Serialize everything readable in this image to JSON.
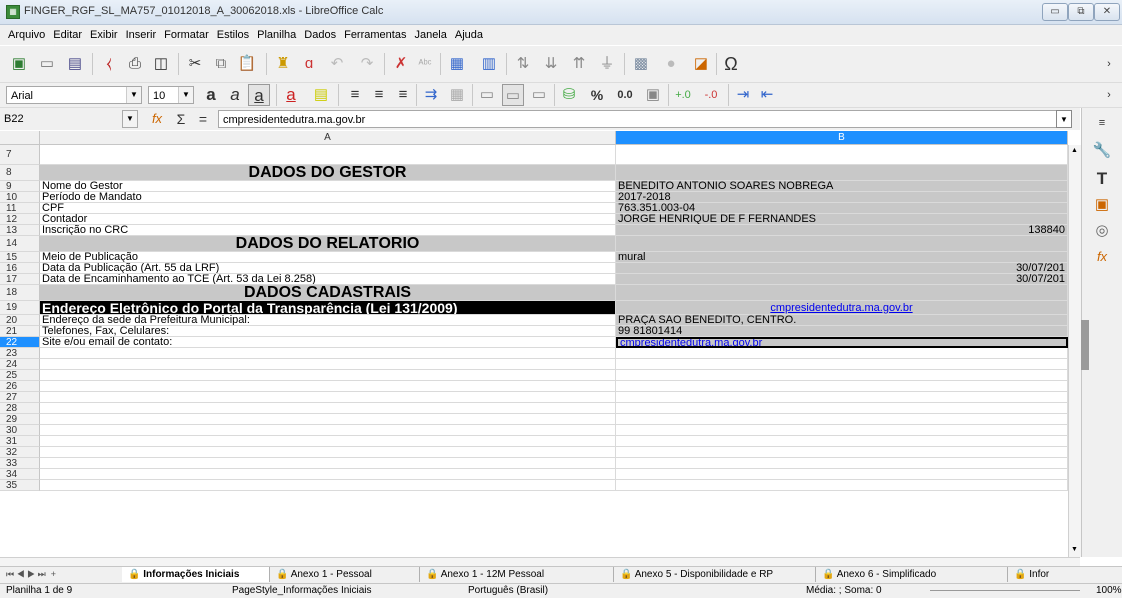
{
  "window": {
    "title": "FINGER_RGF_SL_MA757_01012018_A_30062018.xls - LibreOffice Calc"
  },
  "menu": [
    "Arquivo",
    "Editar",
    "Exibir",
    "Inserir",
    "Formatar",
    "Estilos",
    "Planilha",
    "Dados",
    "Ferramentas",
    "Janela",
    "Ajuda"
  ],
  "format": {
    "font_name": "Arial",
    "font_size": "10",
    "percent": "%",
    "number": "0.0"
  },
  "formula": {
    "cell_ref": "B22",
    "content": "cmpresidentedutra.ma.gov.br"
  },
  "columns": [
    "A",
    "B"
  ],
  "rows": [
    {
      "n": "7",
      "a": "",
      "b": ""
    },
    {
      "n": "8",
      "a": "DADOS DO GESTOR",
      "b": ""
    },
    {
      "n": "9",
      "a": "Nome do Gestor",
      "b": "BENEDITO ANTONIO SOARES NOBREGA"
    },
    {
      "n": "10",
      "a": "Período de Mandato",
      "b": "2017-2018"
    },
    {
      "n": "11",
      "a": "CPF",
      "b": "763.351.003-04"
    },
    {
      "n": "12",
      "a": "Contador",
      "b": "JORGE HENRIQUE DE F FERNANDES"
    },
    {
      "n": "13",
      "a": "Inscrição no CRC",
      "b": "138840"
    },
    {
      "n": "14",
      "a": "DADOS DO RELATÓRIO",
      "b": ""
    },
    {
      "n": "15",
      "a": "Meio de Publicação",
      "b": "mural"
    },
    {
      "n": "16",
      "a": "Data da Publicação (Art. 55 da LRF)",
      "b": "30/07/201"
    },
    {
      "n": "17",
      "a": "Data de Encaminhamento ao TCE (Art. 53 da Lei 8.258)",
      "b": "30/07/201"
    },
    {
      "n": "18",
      "a": "DADOS CADASTRAIS",
      "b": ""
    },
    {
      "n": "19",
      "a": "Endereço Eletrônico do Portal da Transparência (Lei 131/2009)",
      "b": "cmpresidentedutra.ma.gov.br"
    },
    {
      "n": "20",
      "a": "Endereço da sede da Prefeitura Municipal:",
      "b": "PRAÇA SAO BENEDITO, CENTRO."
    },
    {
      "n": "21",
      "a": "Telefones, Fax, Celulares:",
      "b": "99 81801414"
    },
    {
      "n": "22",
      "a": "Site e/ou email de contato:",
      "b": "cmpresidentedutra.ma.gov.br"
    },
    {
      "n": "23",
      "a": "",
      "b": ""
    },
    {
      "n": "24",
      "a": "",
      "b": ""
    },
    {
      "n": "25",
      "a": "",
      "b": ""
    },
    {
      "n": "26",
      "a": "",
      "b": ""
    },
    {
      "n": "27",
      "a": "",
      "b": ""
    },
    {
      "n": "28",
      "a": "",
      "b": ""
    },
    {
      "n": "29",
      "a": "",
      "b": ""
    },
    {
      "n": "30",
      "a": "",
      "b": ""
    },
    {
      "n": "31",
      "a": "",
      "b": ""
    },
    {
      "n": "32",
      "a": "",
      "b": ""
    },
    {
      "n": "33",
      "a": "",
      "b": ""
    },
    {
      "n": "34",
      "a": "",
      "b": ""
    },
    {
      "n": "35",
      "a": "",
      "b": ""
    }
  ],
  "tabs": [
    "Informações Iniciais",
    "Anexo 1 - Pessoal",
    "Anexo 1 - 12M Pessoal",
    "Anexo 5 - Disponibilidade e RP",
    "Anexo 6 - Simplificado",
    "Infor"
  ],
  "status": {
    "sheet": "Planilha 1 de 9",
    "page_style": "PageStyle_Informações Iniciais",
    "language": "Português (Brasil)",
    "sum": "Média: ; Soma: 0",
    "zoom": "100%"
  },
  "colors": {
    "accent": "#1e90ff",
    "gray_cell": "#c8c8c8",
    "header_black": "#000000",
    "link": "#0000ee"
  }
}
